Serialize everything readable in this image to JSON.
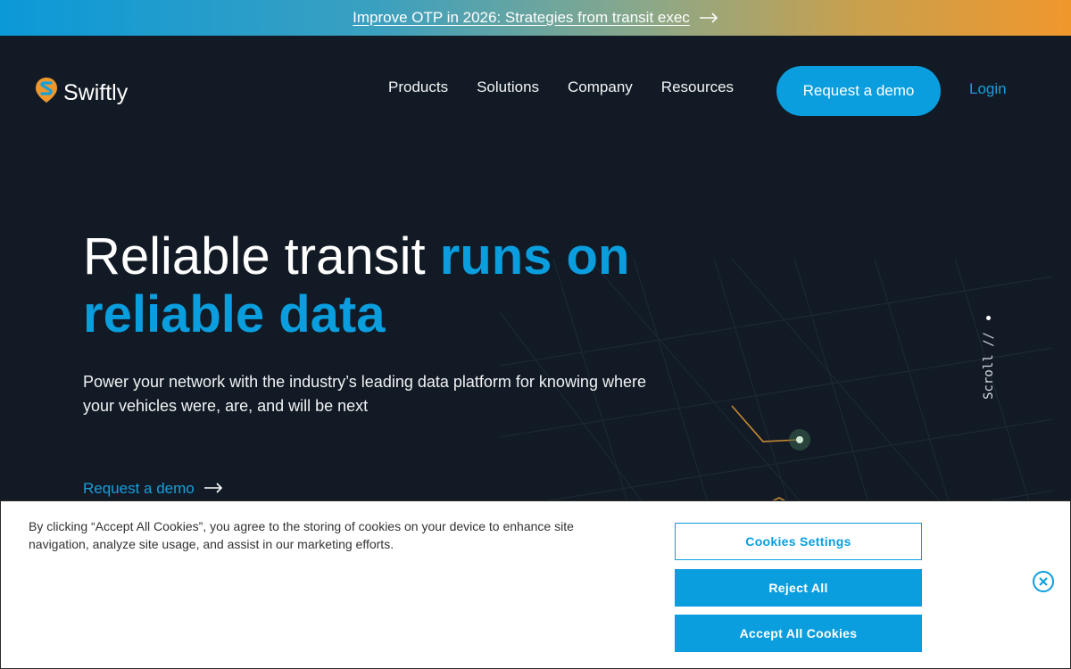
{
  "announcement": {
    "text": "Improve OTP in 2026: Strategies from transit exec",
    "arrow_icon": "arrow-right-icon"
  },
  "header": {
    "logo_text": "Swiftly",
    "nav": [
      "Products",
      "Solutions",
      "Company",
      "Resources"
    ],
    "cta_label": "Request a demo",
    "login_label": "Login"
  },
  "hero": {
    "headline_plain": "Reliable transit ",
    "headline_accent_1": "runs on",
    "headline_accent_2": "reliable data",
    "subtext": "Power your network with the industry’s leading data platform for knowing where your vehicles were, are, and will be next",
    "cta_link": "Request a demo",
    "scroll_label": "Scroll //"
  },
  "cookie_banner": {
    "text": "By clicking “Accept All Cookies”, you agree to the storing of cookies on your device to enhance site navigation, analyze site usage, and assist in our marketing efforts.",
    "settings_button": "Cookies Settings",
    "reject_button": "Reject All",
    "accept_button": "Accept All Cookies",
    "close_icon": "close-icon"
  },
  "colors": {
    "accent": "#0a9ede",
    "background": "#121b25",
    "logo_orange": "#f0972c"
  }
}
